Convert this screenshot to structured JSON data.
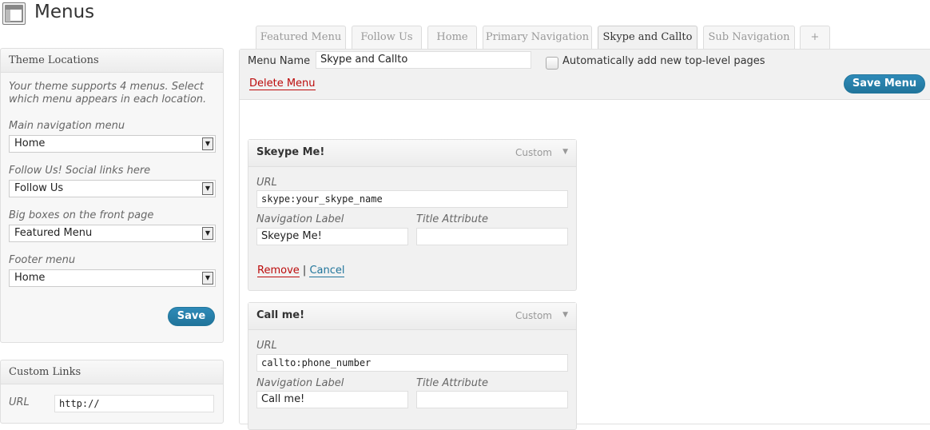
{
  "header": {
    "title": "Menus",
    "icon": "menus-icon"
  },
  "tabs": [
    {
      "label": "Featured Menu",
      "active": false
    },
    {
      "label": "Follow Us",
      "active": false
    },
    {
      "label": "Home",
      "active": false
    },
    {
      "label": "Primary Navigation",
      "active": false
    },
    {
      "label": "Skype and Callto",
      "active": true
    },
    {
      "label": "Sub Navigation",
      "active": false
    },
    {
      "label": "+",
      "active": false
    }
  ],
  "theme_locations": {
    "title": "Theme Locations",
    "description": "Your theme supports 4 menus. Select which menu appears in each location.",
    "locations": [
      {
        "label": "Main navigation menu",
        "value": "Home"
      },
      {
        "label": "Follow Us! Social links here",
        "value": "Follow Us"
      },
      {
        "label": "Big boxes on the front page",
        "value": "Featured Menu"
      },
      {
        "label": "Footer menu",
        "value": "Home"
      }
    ],
    "save_label": "Save"
  },
  "custom_links": {
    "title": "Custom Links",
    "url_label": "URL",
    "url_value": "http://"
  },
  "menu_editor": {
    "name_label": "Menu Name",
    "name_value": "Skype and Callto",
    "auto_add_label": "Automatically add new top-level pages",
    "delete_label": "Delete Menu",
    "save_label": "Save Menu",
    "items": [
      {
        "title": "Skeype Me!",
        "type": "Custom",
        "url_label": "URL",
        "url": "skype:your_skype_name",
        "nav_label_label": "Navigation Label",
        "nav_label": "Skeype Me!",
        "title_attr_label": "Title Attribute",
        "title_attr": "",
        "remove_label": "Remove",
        "separator": "|",
        "cancel_label": "Cancel"
      },
      {
        "title": "Call me!",
        "type": "Custom",
        "url_label": "URL",
        "url": "callto:phone_number",
        "nav_label_label": "Navigation Label",
        "nav_label": "Call me!",
        "title_attr_label": "Title Attribute",
        "title_attr": ""
      }
    ]
  },
  "colors": {
    "accent": "#21759b",
    "danger": "#bc0b0b"
  }
}
